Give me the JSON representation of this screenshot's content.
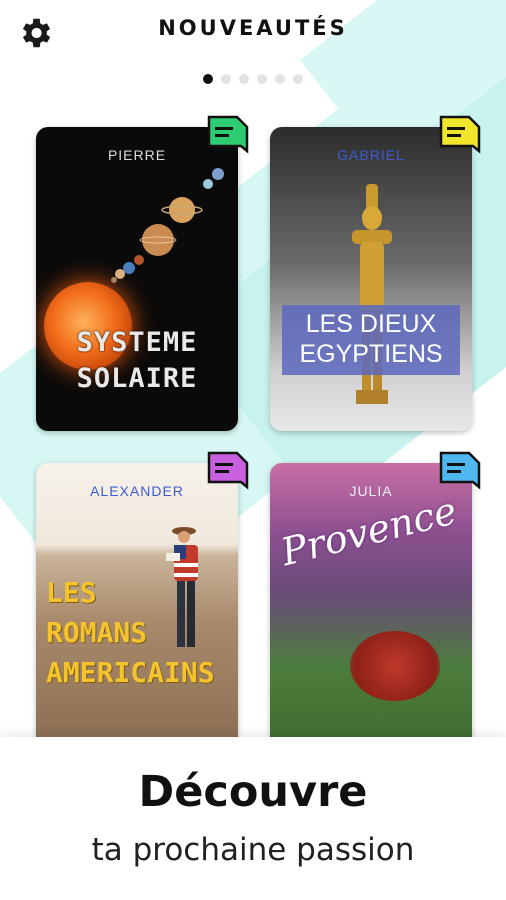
{
  "header": {
    "title": "NOUVEAUTÉS",
    "settings_icon": "gear-icon"
  },
  "pager": {
    "count": 6,
    "active": 0
  },
  "books": [
    {
      "author": "PIERRE",
      "title_lines": [
        "SYSTEME",
        "SOLAIRE"
      ],
      "badge_color": "#2ecc71"
    },
    {
      "author": "GABRIEL",
      "title_lines": [
        "LES DIEUX",
        "EGYPTIENS"
      ],
      "badge_color": "#f1e52c"
    },
    {
      "author": "ALEXANDER",
      "title_lines": [
        "LES",
        "ROMANS",
        "AMERICAINS"
      ],
      "badge_color": "#c860e0"
    },
    {
      "author": "JULIA",
      "title_lines": [
        "Provence"
      ],
      "badge_color": "#4fb8f0"
    }
  ],
  "footer": {
    "headline": "Découvre",
    "subline": "ta prochaine passion"
  },
  "colors": {
    "accent_bg": "#c8f2ee",
    "text": "#111111"
  }
}
